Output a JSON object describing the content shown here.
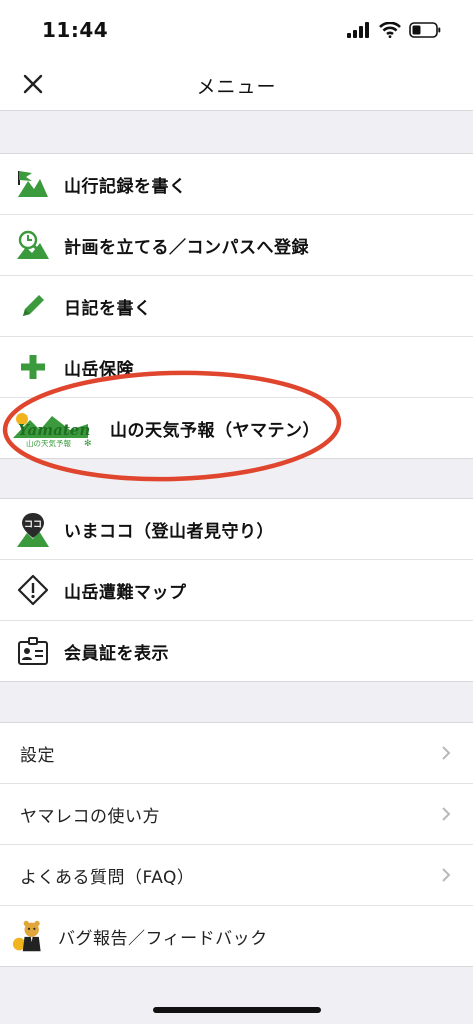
{
  "status": {
    "time": "11:44"
  },
  "nav": {
    "title": "メニュー"
  },
  "section1": [
    {
      "label": "山行記録を書く",
      "icon": "mountain-flag-icon"
    },
    {
      "label": "計画を立てる／コンパスへ登録",
      "icon": "plan-search-icon"
    },
    {
      "label": "日記を書く",
      "icon": "pencil-icon"
    },
    {
      "label": "山岳保険",
      "icon": "plus-icon"
    },
    {
      "label": "山の天気予報（ヤマテン）",
      "icon": "yamaten-logo",
      "logo_text": "Yamaten",
      "logo_subtext": "山の天気予報"
    }
  ],
  "section2": [
    {
      "label": "いまココ（登山者見守り）",
      "icon": "location-pin-icon",
      "pin_text": "ココ"
    },
    {
      "label": "山岳遭難マップ",
      "icon": "warning-diamond-icon"
    },
    {
      "label": "会員証を表示",
      "icon": "id-card-icon"
    }
  ],
  "section3": [
    {
      "label": "設定"
    },
    {
      "label": "ヤマレコの使い方"
    },
    {
      "label": "よくある質問（FAQ）"
    },
    {
      "label": "バグ報告／フィードバック",
      "icon": "bug-report-mascot-icon"
    }
  ],
  "colors": {
    "accent_green": "#3a9a3c",
    "highlight_red": "#e0452e",
    "chevron_gray": "#b8b8bd"
  }
}
